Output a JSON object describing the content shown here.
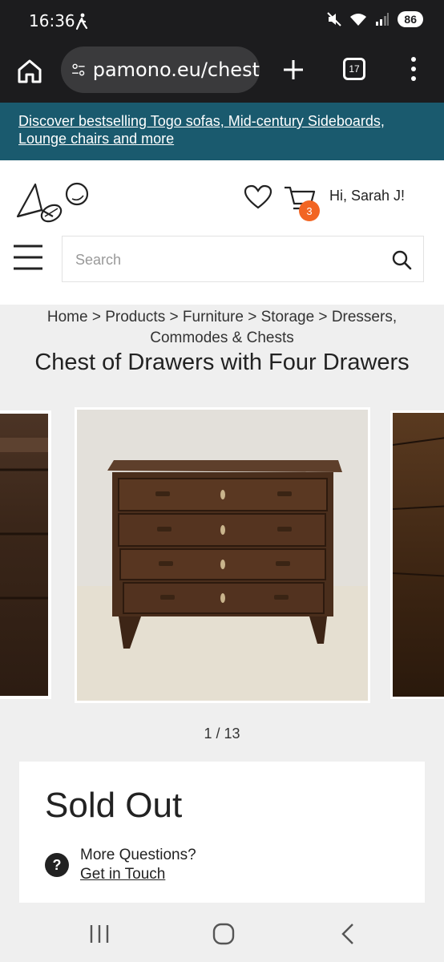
{
  "status": {
    "time": "16:36",
    "battery": "86"
  },
  "browser": {
    "url": "pamono.eu/chest",
    "tab_count": "17"
  },
  "promo": {
    "text": "Discover bestselling Togo sofas, Mid-century Sideboards, Lounge chairs and more"
  },
  "header": {
    "cart_count": "3",
    "greeting": "Hi, Sarah J!"
  },
  "search": {
    "placeholder": "Search"
  },
  "breadcrumb": {
    "items": [
      "Home",
      "Products",
      "Furniture",
      "Storage",
      "Dressers, Commodes & Chests"
    ],
    "separator": ">"
  },
  "product": {
    "title": "Chest of Drawers with Four Drawers",
    "image_counter": "1 / 13",
    "status": "Sold Out"
  },
  "contact": {
    "question": "More Questions?",
    "link": "Get in Touch"
  },
  "colors": {
    "promo_bg": "#1a5a6e",
    "badge": "#f26522"
  }
}
